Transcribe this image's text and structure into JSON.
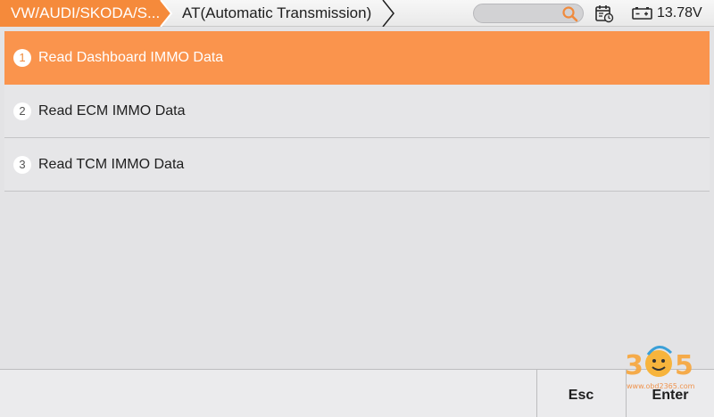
{
  "header": {
    "breadcrumbs": [
      {
        "label": "VW/AUDI/SKODA/S..."
      },
      {
        "label": "AT(Automatic Transmission)"
      }
    ],
    "search": {
      "value": ""
    },
    "icons": [
      "search-icon",
      "calendar-icon",
      "battery-icon"
    ],
    "voltage": "13.78V"
  },
  "menu": {
    "items": [
      {
        "index": "1",
        "label": "Read Dashboard IMMO Data",
        "selected": true
      },
      {
        "index": "2",
        "label": "Read ECM IMMO Data",
        "selected": false
      },
      {
        "index": "3",
        "label": "Read TCM IMMO Data",
        "selected": false
      }
    ]
  },
  "footer": {
    "esc_label": "Esc",
    "enter_label": "Enter"
  },
  "watermark": {
    "text": "www.obd2365.com",
    "digits": "365"
  },
  "colors": {
    "accent": "#fa944d",
    "crumb_active": "#f58a3b",
    "background": "#e3e3e5"
  }
}
